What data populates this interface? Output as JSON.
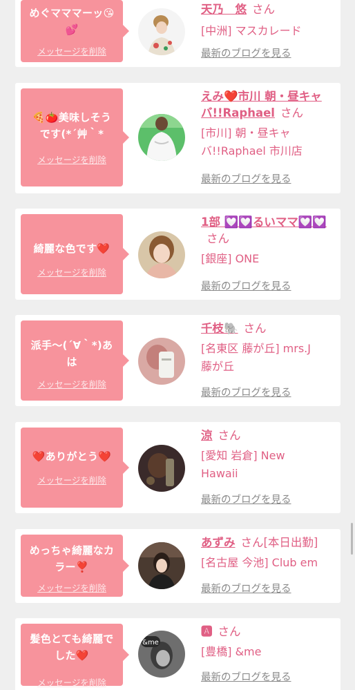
{
  "colors": {
    "background": "#efefef",
    "card": "#ffffff",
    "bubble": "#f7939c",
    "accent_pink": "#e05f84",
    "link_gray": "#8a8a8a"
  },
  "common": {
    "delete_label": "メッセージを削除",
    "san_label": "さん",
    "blog_label": "最新のブログを見る"
  },
  "cards": [
    {
      "message_lines": [
        "めぐマママーッ😘",
        "💕"
      ],
      "name": "天乃　悠",
      "name_suffix": "",
      "shop_lines": [
        "[中洲] マスカレード"
      ]
    },
    {
      "message_lines": [
        "🍕🍅美味しそう",
        "です(*´艸｀*"
      ],
      "name": "えみ❤️市川 朝・昼キャバ!!Raphael",
      "name_suffix": "",
      "shop_lines": [
        "[市川] 朝・昼キャ",
        "バ!!Raphael 市川店"
      ]
    },
    {
      "message_lines": [
        "綺麗な色です❤️"
      ],
      "name": "1部 💟💟るいママ💟💟",
      "name_suffix": "",
      "shop_lines": [
        "[銀座] ONE"
      ]
    },
    {
      "message_lines": [
        "派手〜(´∀｀*)あ",
        "は"
      ],
      "name": "千枝🐘",
      "name_suffix": "",
      "shop_lines": [
        "[名東区 藤が丘] mrs.J",
        "藤が丘"
      ]
    },
    {
      "message_lines": [
        "❤️ありがとう❤️"
      ],
      "name": "涼",
      "name_suffix": "",
      "shop_lines": [
        "[愛知 岩倉] New",
        "Hawaii"
      ]
    },
    {
      "message_lines": [
        "めっちゃ綺麗なカ",
        "ラー❣️"
      ],
      "name": "あずみ",
      "name_suffix": "[本日出勤]",
      "shop_lines": [
        "[名古屋 今池] Club em"
      ]
    },
    {
      "message_lines": [
        "髪色とても綺麗で",
        "した❤️"
      ],
      "name": "🅰",
      "name_suffix": "",
      "shop_lines": [
        "[豊橋] &me"
      ]
    }
  ]
}
